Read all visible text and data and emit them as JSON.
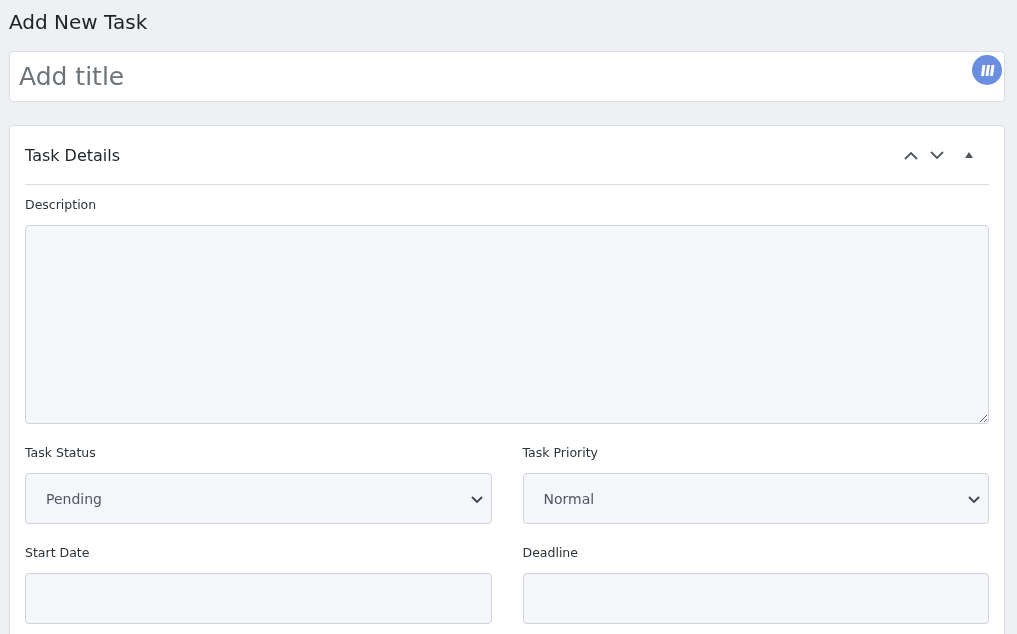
{
  "page": {
    "title": "Add New Task"
  },
  "title_field": {
    "placeholder": "Add title"
  },
  "panel": {
    "title": "Task Details",
    "expanded": true,
    "fields": [
      {
        "kind": "textarea",
        "label": "Description"
      },
      {
        "kind": "select",
        "label": "Task Status",
        "value": "Pending"
      },
      {
        "kind": "select",
        "label": "Task Priority",
        "value": "Normal"
      },
      {
        "kind": "date",
        "label": "Start Date"
      },
      {
        "kind": "date",
        "label": "Deadline"
      }
    ]
  }
}
